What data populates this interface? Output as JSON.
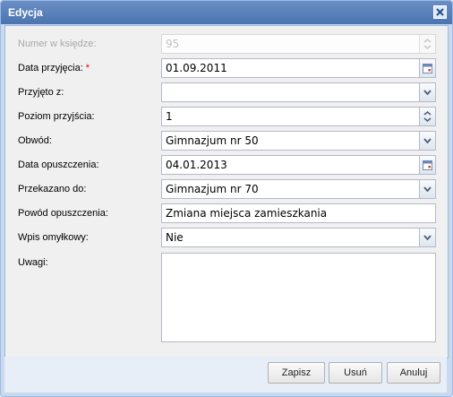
{
  "window": {
    "title": "Edycja"
  },
  "form": {
    "rows": [
      {
        "label": "Numer w księdze:",
        "value": "95",
        "required": false,
        "disabled": true,
        "control": "spinner"
      },
      {
        "label": "Data przyjęcia:",
        "value": "01.09.2011",
        "required": true,
        "required_mark": "*",
        "control": "date"
      },
      {
        "label": "Przyjęto z:",
        "value": "",
        "required": false,
        "control": "select"
      },
      {
        "label": "Poziom przyjścia:",
        "value": "1",
        "required": false,
        "control": "spinner"
      },
      {
        "label": "Obwód:",
        "value": "Gimnazjum nr 50",
        "required": false,
        "control": "select"
      },
      {
        "label": "Data opuszczenia:",
        "value": "04.01.2013",
        "required": false,
        "control": "date"
      },
      {
        "label": "Przekazano do:",
        "value": "Gimnazjum nr 70",
        "required": false,
        "control": "select"
      },
      {
        "label": "Powód opuszczenia:",
        "value": "Zmiana miejsca zamieszkania",
        "required": false,
        "control": "text"
      },
      {
        "label": "Wpis omyłkowy:",
        "value": "Nie",
        "required": false,
        "control": "select"
      },
      {
        "label": "Uwagi:",
        "value": "",
        "required": false,
        "control": "textarea"
      }
    ]
  },
  "buttons": {
    "save": "Zapisz",
    "delete": "Usuń",
    "cancel": "Anuluj"
  },
  "colors": {
    "titlebar": "#4a74b0",
    "border": "#99bbe8",
    "required": "#ee0000"
  }
}
